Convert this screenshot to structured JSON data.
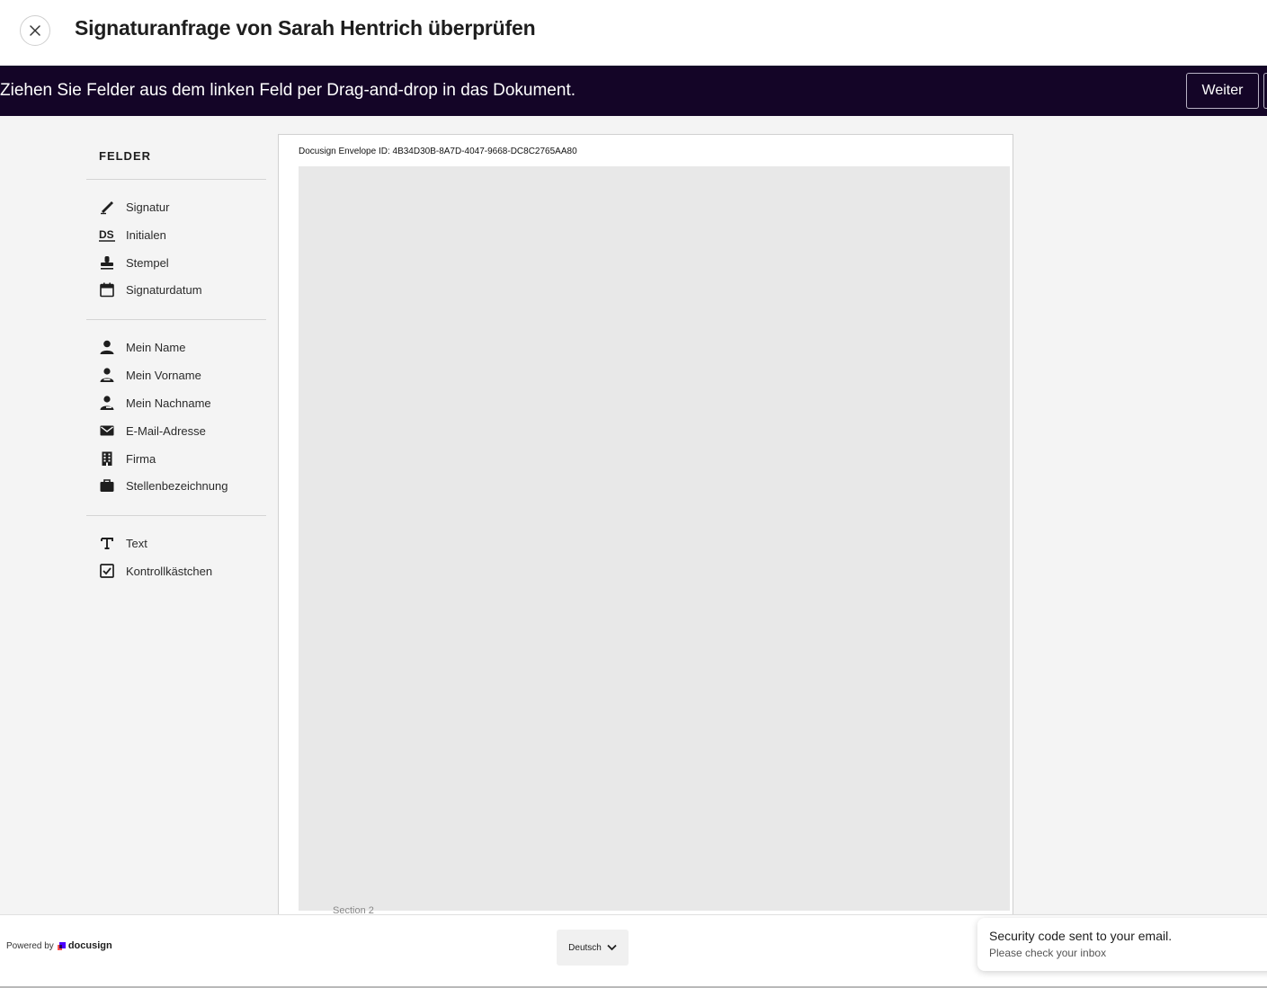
{
  "header": {
    "title": "Signaturanfrage von Sarah Hentrich überprüfen",
    "close_icon": "close-icon"
  },
  "banner": {
    "text": "Ziehen Sie Felder aus dem linken Feld per Drag-and-drop in das Dokument.",
    "next_label": "Weiter"
  },
  "sidebar": {
    "heading": "FELDER",
    "groups": [
      [
        {
          "label": "Signatur",
          "icon": "pen-icon"
        },
        {
          "label": "Initialen",
          "icon": "initials-icon"
        },
        {
          "label": "Stempel",
          "icon": "stamp-icon"
        },
        {
          "label": "Signaturdatum",
          "icon": "calendar-icon"
        }
      ],
      [
        {
          "label": "Mein Name",
          "icon": "person-icon"
        },
        {
          "label": "Mein Vorname",
          "icon": "person-first-icon"
        },
        {
          "label": "Mein Nachname",
          "icon": "person-last-icon"
        },
        {
          "label": "E-Mail-Adresse",
          "icon": "envelope-icon"
        },
        {
          "label": "Firma",
          "icon": "building-icon"
        },
        {
          "label": "Stellenbezeichnung",
          "icon": "briefcase-icon"
        }
      ],
      [
        {
          "label": "Text",
          "icon": "text-icon"
        },
        {
          "label": "Kontrollkästchen",
          "icon": "checkbox-icon"
        }
      ]
    ]
  },
  "document": {
    "envelope_id": "Docusign Envelope ID: 4B34D30B-8A7D-4047-9668-DC8C2765AA80",
    "section_label": "Section 2"
  },
  "footer": {
    "powered_by": "Powered by",
    "brand": "docusign",
    "language": "Deutsch"
  },
  "toast": {
    "title": "Security code sent to your email.",
    "message": "Please check your inbox"
  },
  "colors": {
    "banner_bg": "#140527",
    "brand_blue": "#4c00ff",
    "brand_red": "#ff5252"
  }
}
